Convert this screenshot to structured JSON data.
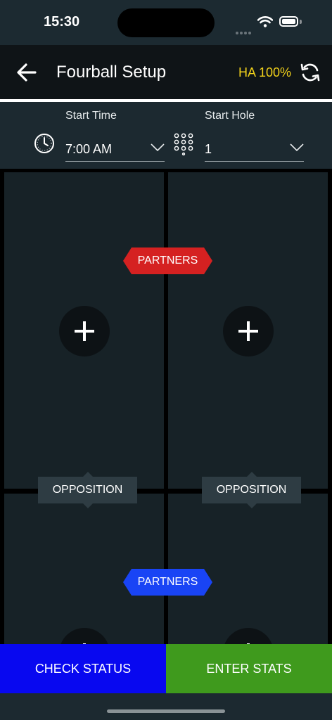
{
  "status_bar": {
    "time": "15:30"
  },
  "header": {
    "title": "Fourball Setup",
    "handicap_allowance": "HA 100%"
  },
  "settings": {
    "start_time": {
      "label": "Start Time",
      "value": "7:00 AM"
    },
    "start_hole": {
      "label": "Start Hole",
      "value": "1"
    }
  },
  "matchup": {
    "partners_top_label": "PARTNERS",
    "opposition_left_label": "OPPOSITION",
    "opposition_right_label": "OPPOSITION",
    "partners_bottom_label": "PARTNERS"
  },
  "footer": {
    "check_status_label": "CHECK STATUS",
    "enter_stats_label": "ENTER STATS"
  },
  "colors": {
    "accent_yellow": "#f2d21b",
    "partners_red": "#d52121",
    "partners_blue": "#1944f5",
    "check_status": "#0808f0",
    "enter_stats": "#3f9a1d"
  },
  "icons": [
    "back-arrow-icon",
    "refresh-icon",
    "clock-icon",
    "keypad-icon",
    "chevron-down-icon",
    "plus-icon"
  ]
}
